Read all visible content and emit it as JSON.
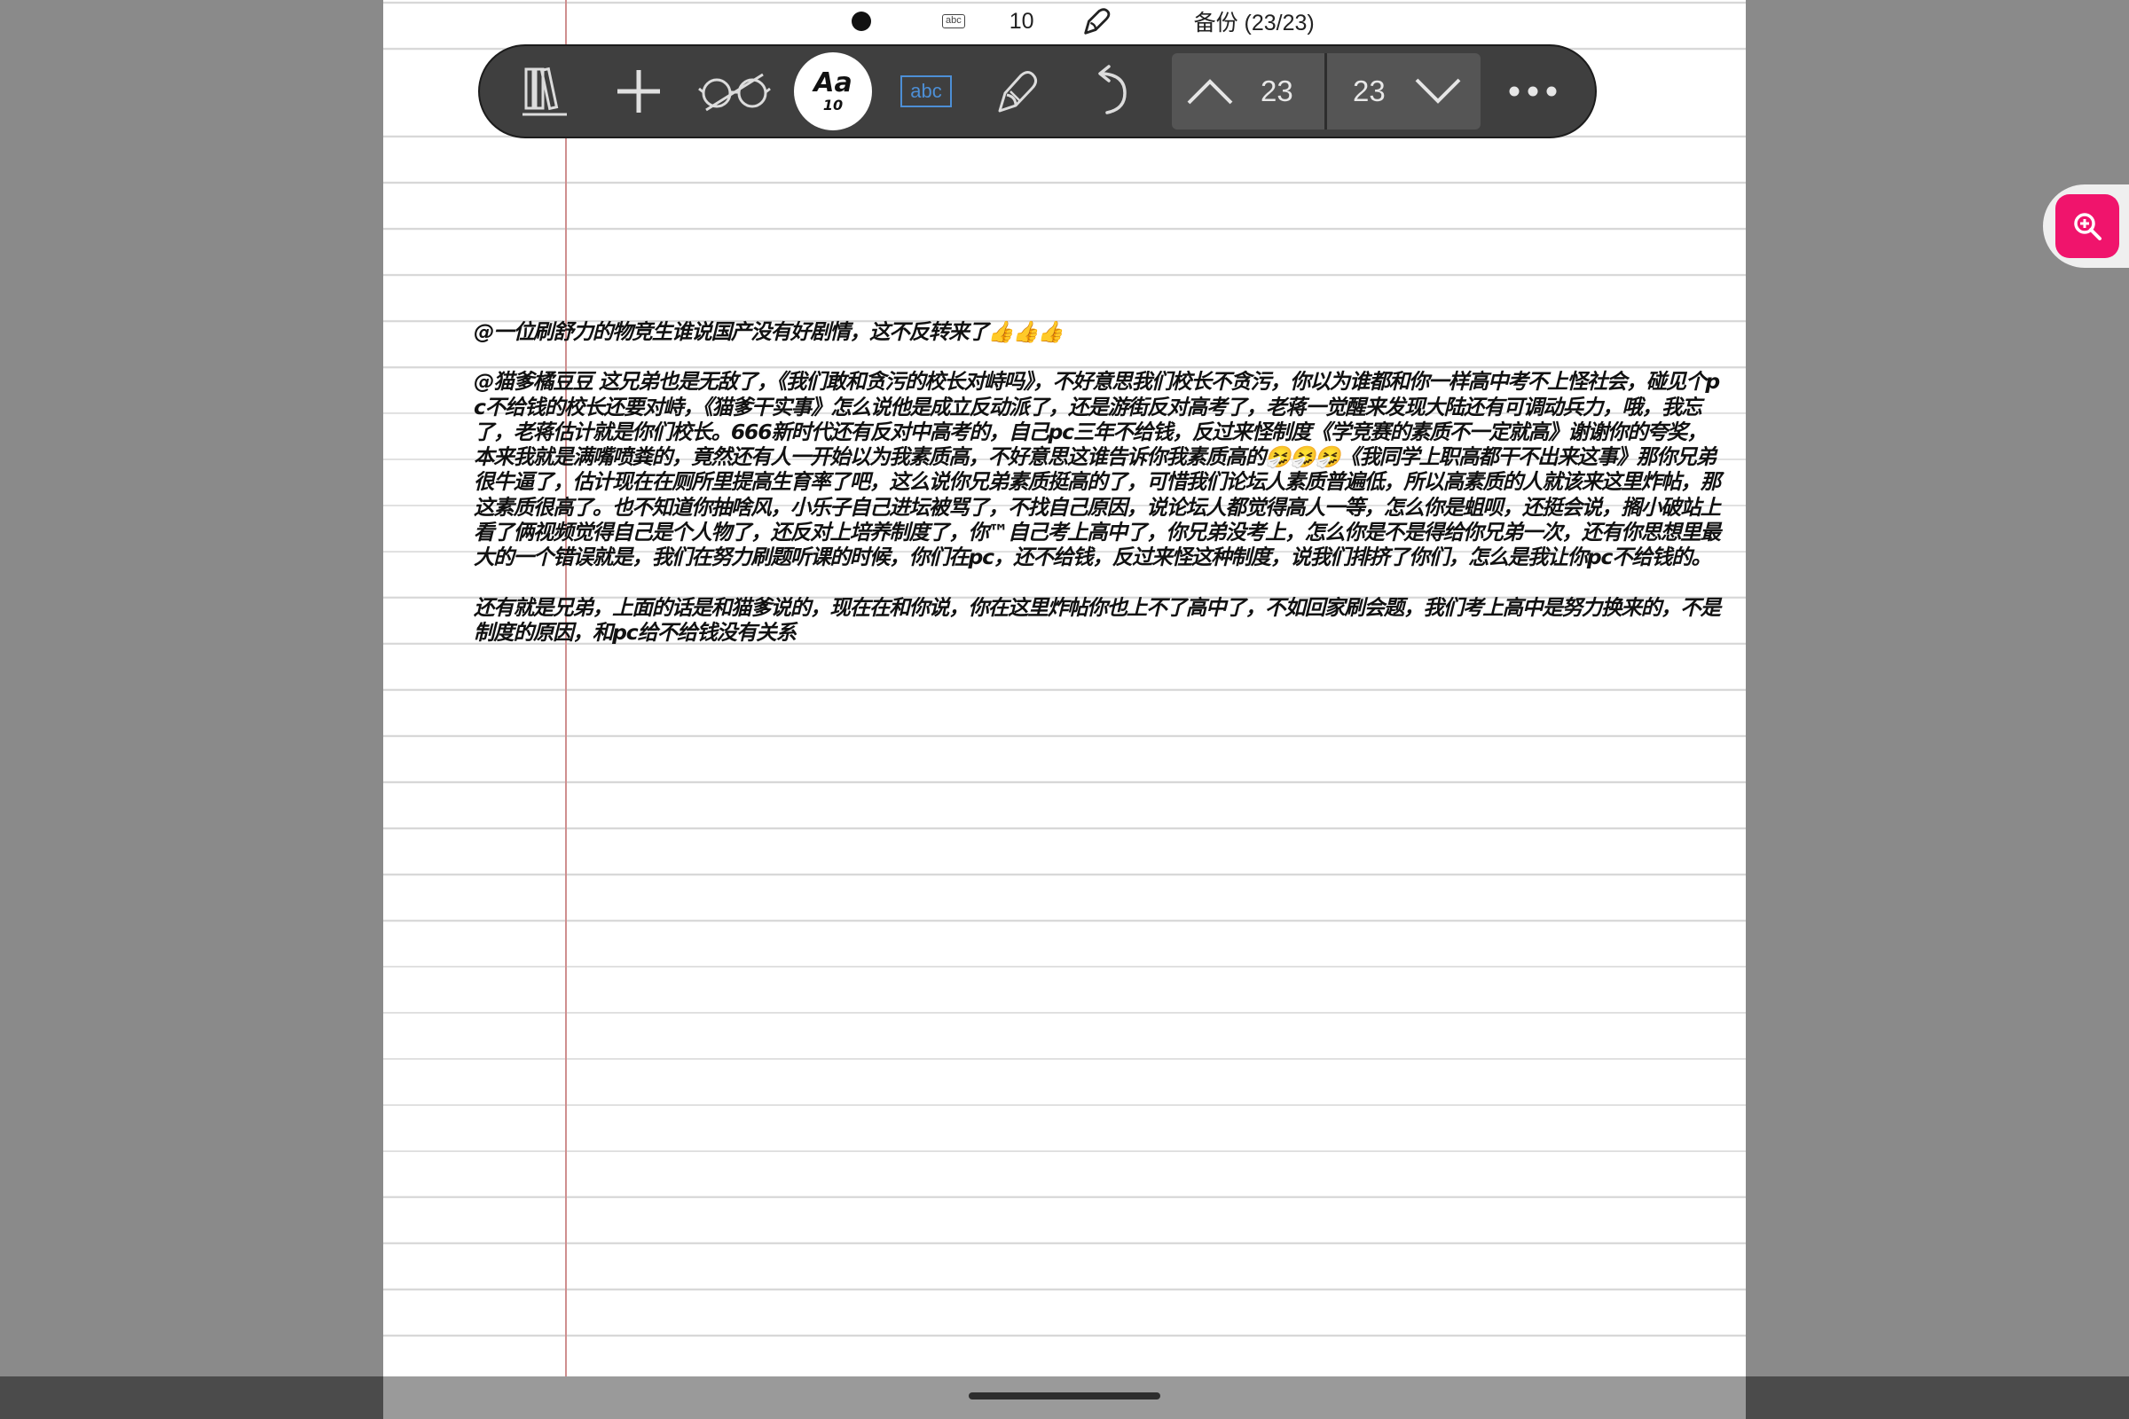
{
  "status_strip": {
    "pen_size": "10",
    "abc_label": "abc",
    "backup_label": "备份 (23/23)"
  },
  "toolbar": {
    "font_button": {
      "label": "Aa",
      "size": "10"
    },
    "text_tool_label": "abc",
    "page_nav": {
      "current_page": "23",
      "total_pages": "23"
    },
    "accent_color": "#4d8fd6"
  },
  "zoom_button": {
    "color": "#f0146c",
    "icon": "zoom-in-icon"
  },
  "note": {
    "paragraphs": [
      "@一位刷舒力的物竞生谁说国产没有好剧情，这不反转来了👍👍👍",
      "@猫爹橘豆豆 这兄弟也是无敌了，《我们敢和贪污的校长对峙吗》，不好意思我们校长不贪污，你以为谁都和你一样高中考不上怪社会，碰见个pc不给钱的校长还要对峙，《猫爹干实事》怎么说他是成立反动派了，还是游街反对高考了，老蒋一觉醒来发现大陆还有可调动兵力，哦，我忘了，老蒋估计就是你们校长。666新时代还有反对中高考的，自己pc三年不给钱，反过来怪制度《学竞赛的素质不一定就高》谢谢你的夸奖，本来我就是满嘴喷粪的，竟然还有人一开始以为我素质高，不好意思这谁告诉你我素质高的🤧🤧🤧《我同学上职高都干不出来这事》那你兄弟很牛逼了，估计现在在厕所里提高生育率了吧，这么说你兄弟素质挺高的了，可惜我们论坛人素质普遍低，所以高素质的人就该来这里炸帖，那这素质很高了。也不知道你抽啥风，小乐子自己进坛被骂了，不找自己原因，说论坛人都觉得高人一等，怎么你是蛆呗，还挺会说，搁小破站上看了俩视频觉得自己是个人物了，还反对上培养制度了，你™自己考上高中了，你兄弟没考上，怎么你是不是得给你兄弟一次，还有你思想里最大的一个错误就是，我们在努力刷题听课的时候，你们在pc，还不给钱，反过来怪这种制度，说我们排挤了你们，怎么是我让你pc不给钱的。",
      "还有就是兄弟，上面的话是和猫爹说的，现在在和你说，你在这里炸帖你也上不了高中了，不如回家刷会题，我们考上高中是努力换来的，不是制度的原因，和pc给不给钱没有关系"
    ]
  }
}
